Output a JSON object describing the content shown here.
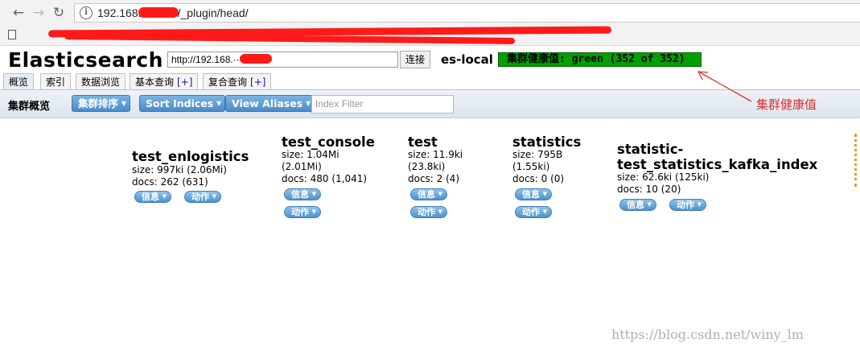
{
  "browser": {
    "back_glyph": "←",
    "forward_glyph": "→",
    "reload_glyph": "↻",
    "info_glyph": "i",
    "url": "192.168.···9200/_plugin/head/",
    "redaction_color": "#ff1a1a"
  },
  "app": {
    "title": "Elasticsearch",
    "connect_url": "http://192.168.···9200/",
    "connect_label": "连接",
    "cluster_name": "es-local",
    "health_text": "集群健康值: green (352 of 352)",
    "health_color": "#00a000"
  },
  "tabs": [
    {
      "label": "概览",
      "plus": ""
    },
    {
      "label": "索引",
      "plus": ""
    },
    {
      "label": "数据浏览",
      "plus": ""
    },
    {
      "label": "基本查询",
      "plus": "[+]"
    },
    {
      "label": "复合查询",
      "plus": "[+]"
    }
  ],
  "filterbar": {
    "overview_label": "集群概览",
    "sort_label": "集群排序",
    "sort_indices_label": "Sort Indices",
    "view_aliases_label": "View Aliases",
    "caret": "▼",
    "index_filter_placeholder": "Index Filter"
  },
  "annotation": {
    "text": "集群健康值",
    "color": "#e03030"
  },
  "indices": [
    {
      "name": "test_enlogistics",
      "name2": "",
      "size": "size: 997ki (2.06Mi)",
      "size2": "",
      "docs": "docs: 262 (631)",
      "info": "信息",
      "action": "动作"
    },
    {
      "name": "test_console",
      "name2": "",
      "size": "size: 1.04Mi",
      "size2": "(2.01Mi)",
      "docs": "docs: 480 (1,041)",
      "info": "信息",
      "action": "动作"
    },
    {
      "name": "test",
      "name2": "",
      "size": "size: 11.9ki",
      "size2": "(23.8ki)",
      "docs": "docs: 2 (4)",
      "info": "信息",
      "action": "动作"
    },
    {
      "name": "statistics",
      "name2": "",
      "size": "size: 795B",
      "size2": "(1.55ki)",
      "docs": "docs: 0 (0)",
      "info": "信息",
      "action": "动作"
    },
    {
      "name": "statistic-",
      "name2": "test_statistics_kafka_index",
      "size": "size: 62.6ki (125ki)",
      "size2": "",
      "docs": "docs: 10 (20)",
      "info": "信息",
      "action": "动作"
    }
  ],
  "watermark": "https://blog.csdn.net/winy_lm"
}
